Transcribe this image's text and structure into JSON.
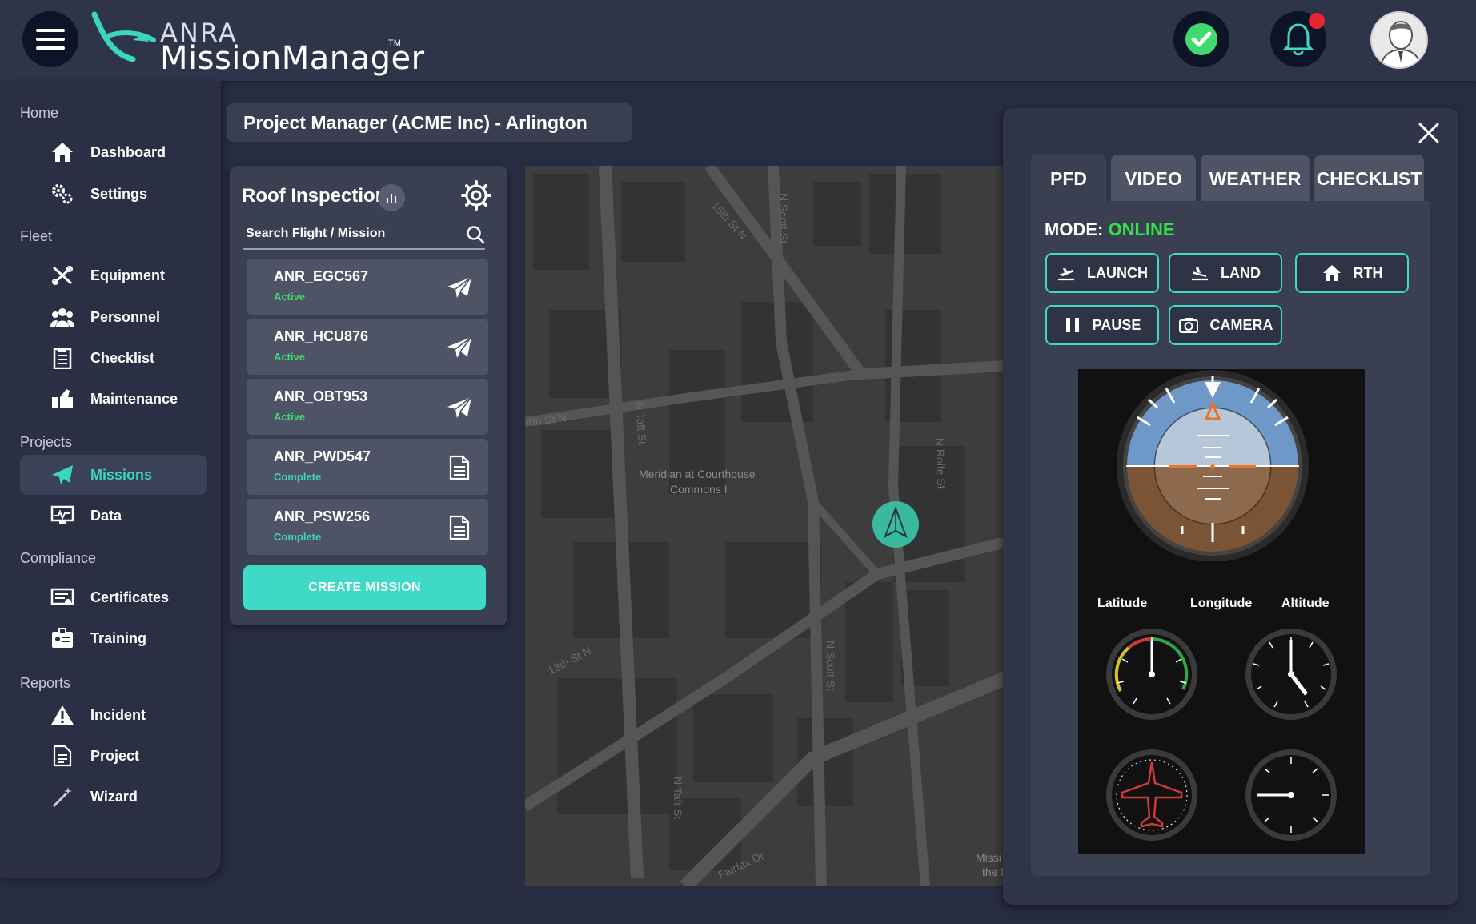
{
  "header": {
    "brand": "ANRA",
    "product": "MissionManager",
    "trademark": "TM"
  },
  "sidebar": {
    "sections": [
      {
        "title": "Home",
        "items": [
          {
            "label": "Dashboard",
            "icon": "home-icon"
          },
          {
            "label": "Settings",
            "icon": "gears-icon"
          }
        ]
      },
      {
        "title": "Fleet",
        "items": [
          {
            "label": "Equipment",
            "icon": "tools-icon"
          },
          {
            "label": "Personnel",
            "icon": "people-icon"
          },
          {
            "label": "Checklist",
            "icon": "clipboard-icon"
          },
          {
            "label": "Maintenance",
            "icon": "maintenance-icon"
          }
        ]
      },
      {
        "title": "Projects",
        "items": [
          {
            "label": "Missions",
            "icon": "paper-plane-icon"
          },
          {
            "label": "Data",
            "icon": "monitor-icon"
          }
        ]
      },
      {
        "title": "Compliance",
        "items": [
          {
            "label": "Certificates",
            "icon": "certificate-icon"
          },
          {
            "label": "Training",
            "icon": "id-card-icon"
          }
        ]
      },
      {
        "title": "Reports",
        "items": [
          {
            "label": "Incident",
            "icon": "warning-icon"
          },
          {
            "label": "Project",
            "icon": "document-icon"
          },
          {
            "label": "Wizard",
            "icon": "wand-icon"
          }
        ]
      }
    ],
    "active_item": "Missions"
  },
  "project": {
    "title": "Project Manager (ACME Inc) - Arlington"
  },
  "mission_panel": {
    "title": "Roof Inspection",
    "search_placeholder": "Search Flight / Mission",
    "flights": [
      {
        "id": "ANR_EGC567",
        "status": "Active",
        "icon": "paper-plane-icon"
      },
      {
        "id": "ANR_HCU876",
        "status": "Active",
        "icon": "paper-plane-icon"
      },
      {
        "id": "ANR_OBT953",
        "status": "Active",
        "icon": "paper-plane-icon"
      },
      {
        "id": "ANR_PWD547",
        "status": "Complete",
        "icon": "document-icon"
      },
      {
        "id": "ANR_PSW256",
        "status": "Complete",
        "icon": "document-icon"
      }
    ],
    "create_label": "CREATE MISSION"
  },
  "map": {
    "streets": [
      "15th St N",
      "N Scott St",
      "4th St N",
      "N Taft St",
      "N Rolfe St",
      "13th St N",
      "N Scott St",
      "N Taft St",
      "Fairfax Dr"
    ],
    "poi": [
      "Meridian at Courthouse",
      "Commons I"
    ],
    "edge_labels": [
      "Missi",
      "the l"
    ]
  },
  "pfd": {
    "tabs": [
      "PFD",
      "VIDEO",
      "WEATHER",
      "CHECKLIST"
    ],
    "active_tab": "PFD",
    "mode_label": "MODE:",
    "mode_value": "ONLINE",
    "buttons": {
      "launch": "LAUNCH",
      "land": "LAND",
      "rth": "RTH",
      "pause": "PAUSE",
      "camera": "CAMERA"
    },
    "instrument_labels": [
      "Latitude",
      "Longitude",
      "Altitude"
    ]
  },
  "colors": {
    "accent": "#3edac5",
    "online": "#35e04a",
    "active_status": "#3edc6e",
    "notification": "#e8242f"
  }
}
